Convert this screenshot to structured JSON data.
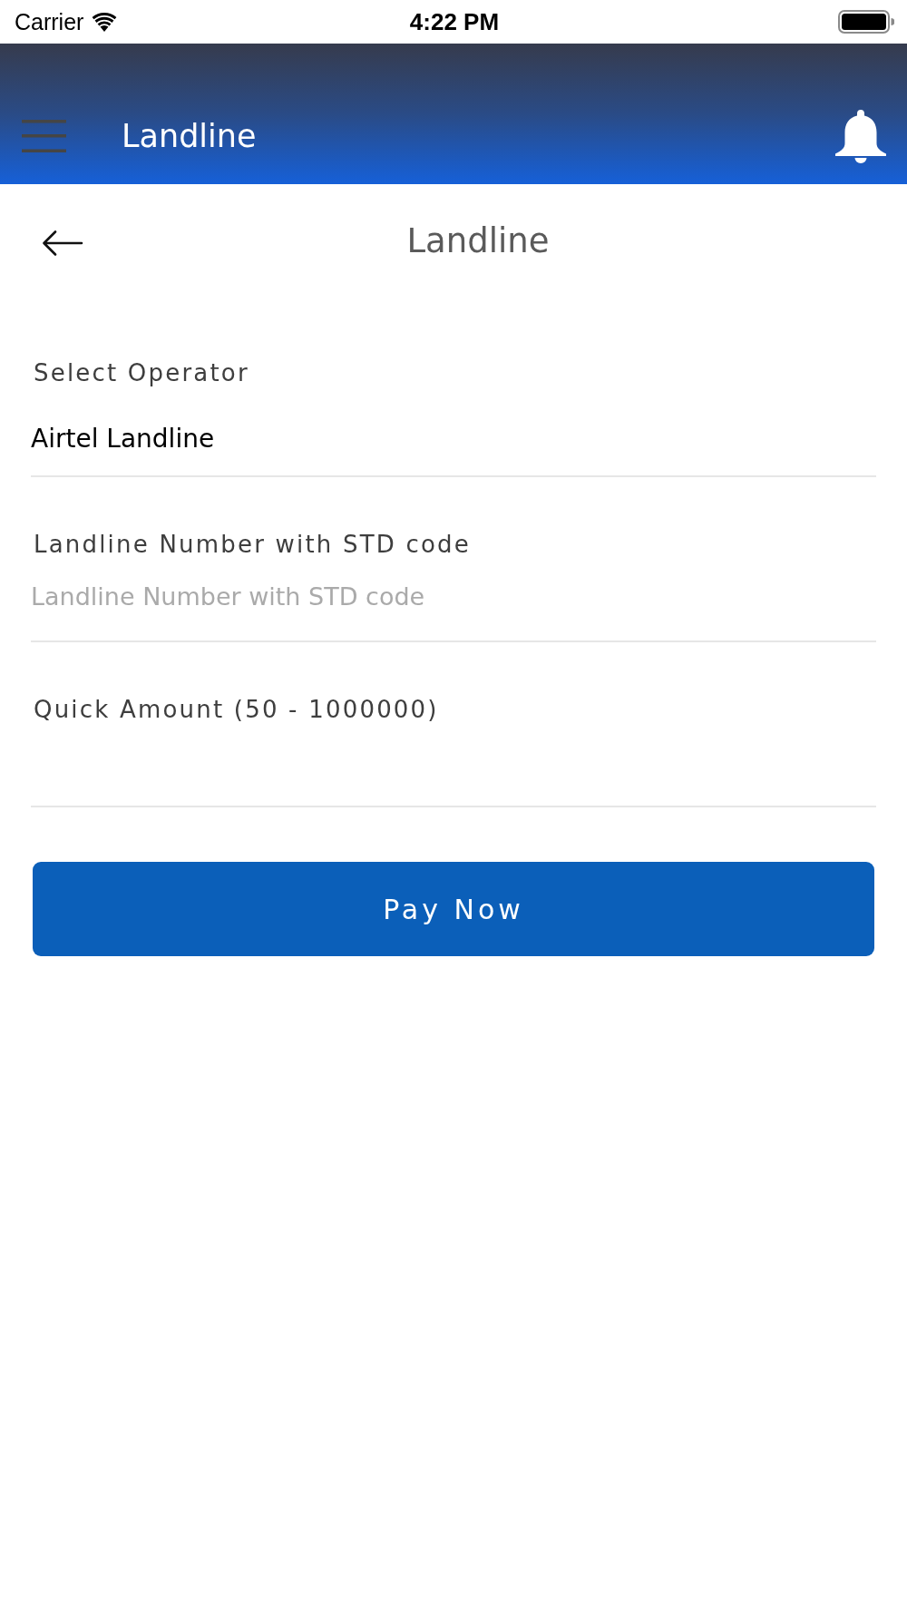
{
  "status_bar": {
    "carrier": "Carrier",
    "time": "4:22 PM"
  },
  "app_bar": {
    "title": "Landline"
  },
  "page": {
    "title": "Landline"
  },
  "fields": [
    {
      "label": "Select Operator",
      "value": "Airtel Landline"
    },
    {
      "label": "Landline Number with STD code",
      "placeholder": "Landline Number with STD code"
    },
    {
      "label": "Quick Amount (50 - 1000000)"
    }
  ],
  "pay_button": {
    "label": "Pay Now"
  }
}
